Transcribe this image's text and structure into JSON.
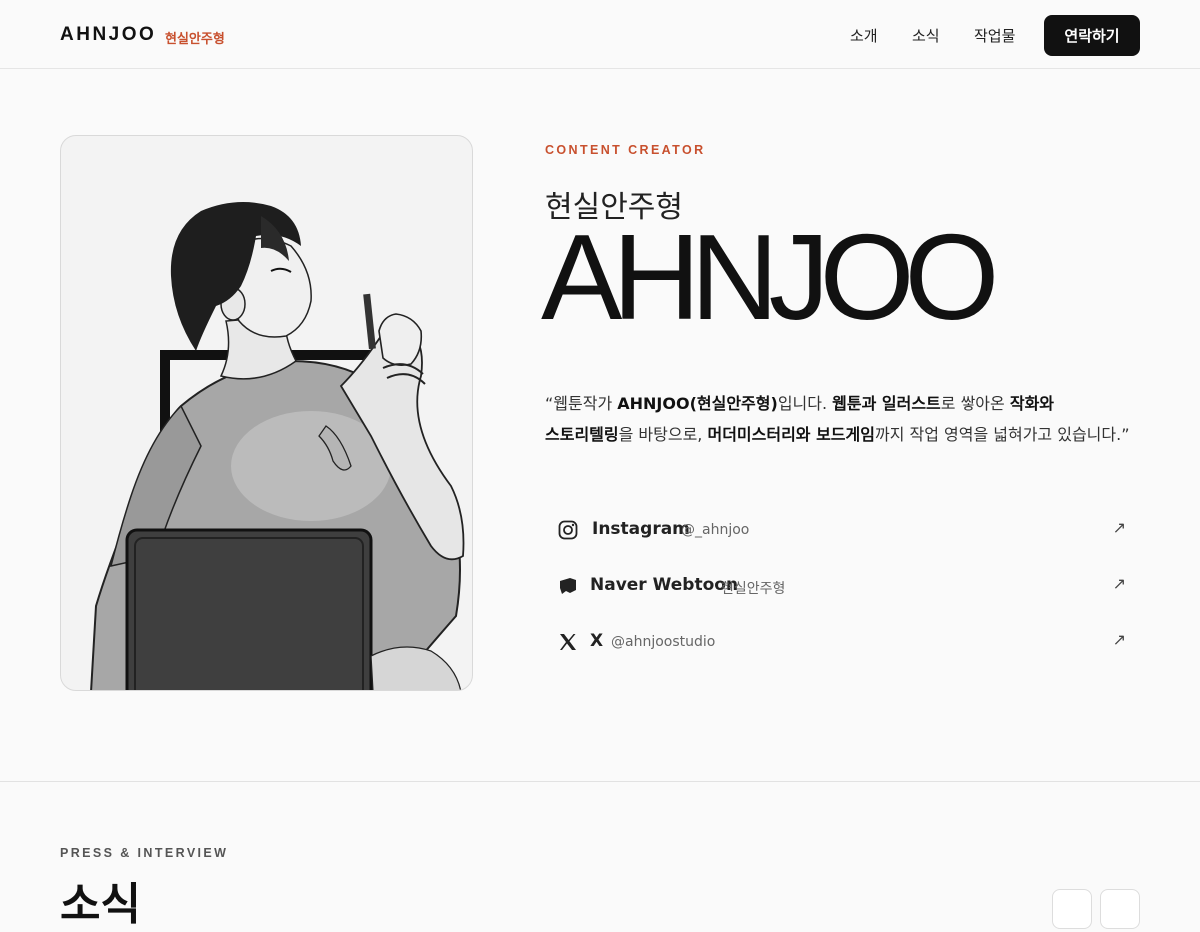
{
  "header": {
    "logo": "AHNJOO",
    "logo_sub": "현실안주형",
    "nav": [
      "소개",
      "소식",
      "작업물"
    ],
    "cta": "연락하기"
  },
  "intro": {
    "eyebrow": "CONTENT CREATOR",
    "korean_name": "현실안주형",
    "name": "AHNJOO",
    "quote": {
      "q1": "“웹툰작가 ",
      "b1": "AHNJOO(현실안주형)",
      "q2": "입니다. ",
      "b2": "웹툰과 일러스트",
      "q3": "로 쌓아온 ",
      "b3": "작화와",
      "b4": "스토리텔링",
      "q4": "을 바탕으로, ",
      "b5": "머더미스터리와 보드게임",
      "q5": "까지 작업 영역을 넓혀가고 있습니다.”"
    }
  },
  "social": [
    {
      "name": "Instagram",
      "handle": "@_ahnjoo",
      "icon": "instagram-icon",
      "arrow": "↗"
    },
    {
      "name": "Naver Webtoon",
      "handle": "현실안주형",
      "icon": "naver-webtoon-icon",
      "arrow": "↗"
    },
    {
      "name": "X",
      "handle": "@ahnjoostudio",
      "icon": "x-icon",
      "arrow": "↗"
    }
  ],
  "news": {
    "eyebrow": "PRESS & INTERVIEW",
    "title": "소식"
  },
  "colors": {
    "accent": "#c8502e",
    "dark": "#111111",
    "background": "#fafafa"
  }
}
